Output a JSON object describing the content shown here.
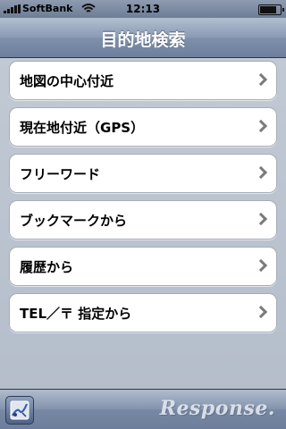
{
  "status_bar": {
    "carrier": "SoftBank",
    "time": "12:13",
    "battery_level": 0.85
  },
  "nav": {
    "title": "目的地検索"
  },
  "menu": {
    "items": [
      {
        "label": "地図の中心付近"
      },
      {
        "label": "現在地付近（GPS）"
      },
      {
        "label": "フリーワード"
      },
      {
        "label": "ブックマークから"
      },
      {
        "label": "履歴から"
      },
      {
        "label": "TEL／〒 指定から"
      }
    ]
  },
  "toolbar": {
    "watermark": "Response."
  },
  "colors": {
    "nav_blue": "#7f90ab",
    "cell_bg": "#ffffff",
    "chevron": "#7a7a7a"
  }
}
